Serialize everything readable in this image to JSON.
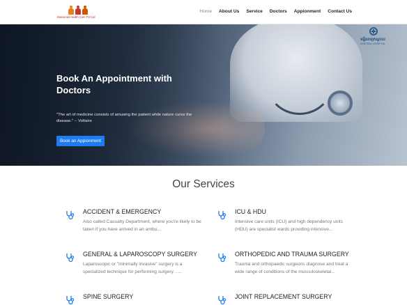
{
  "header": {
    "logo_text": "Basavnali Health Care Pvt Ltd",
    "nav": [
      {
        "label": "Home",
        "active": true
      },
      {
        "label": "About Us",
        "active": false
      },
      {
        "label": "Service",
        "active": false
      },
      {
        "label": "Doctors",
        "active": false
      },
      {
        "label": "Appionment",
        "active": false
      },
      {
        "label": "Contact Us",
        "active": false
      }
    ]
  },
  "hero": {
    "title": "Book An Appointment with Doctors",
    "quote": "\"The art of medicine consists of amusing the patient while nature cures the disease.\" -- Voltaire",
    "button_label": "Book an Appionment",
    "hospital_logo_script": "មន្ទីរពេទ្យកណ្តាល",
    "hospital_logo_sub": "CENTRAL HOSPITAL",
    "carousel_slides": 3,
    "carousel_active": 2
  },
  "services": {
    "title": "Our Services",
    "icon": "stethoscope-icon",
    "accent_color": "#1e7cf2",
    "items": [
      {
        "title": "ACCIDENT & EMERGENCY",
        "desc": "Also called Casualty Department, where you're likely to be taken if you have arrived in an ambu..."
      },
      {
        "title": "ICU & HDU",
        "desc": "Intensive care units (ICU) and high dependency units (HDU) are specialist wards providing intensive..."
      },
      {
        "title": "GENERAL & LAPAROSCOPY SURGERY",
        "desc": "Laparoscopic or \"minimally invasive\" surgery is a specialized technique for performing surgery. ....."
      },
      {
        "title": "ORTHOPEDIC AND TRAUMA SURGERY",
        "desc": "Trauma and orthopaedic surgeons diagnose and treat a wide range of conditions of the musculoskeletal..."
      },
      {
        "title": "SPINE SURGERY",
        "desc": ""
      },
      {
        "title": "JOINT REPLACEMENT SURGERY",
        "desc": ""
      }
    ]
  }
}
